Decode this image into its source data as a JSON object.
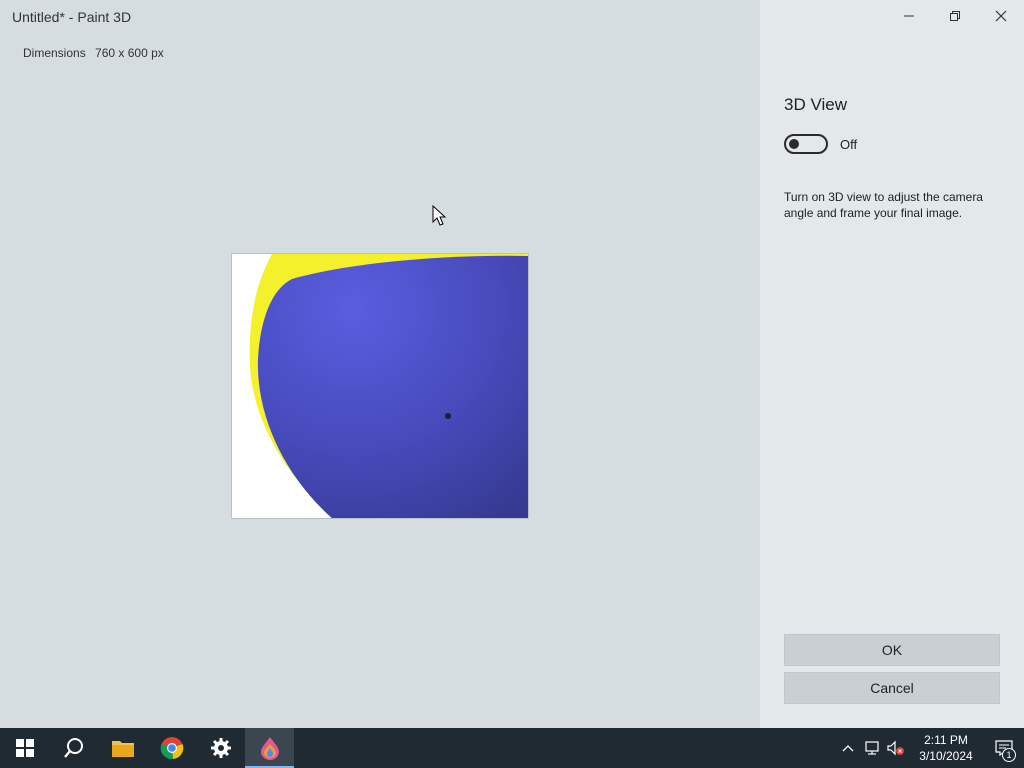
{
  "window": {
    "title": "Untitled* - Paint 3D",
    "dimensions_label": "Dimensions",
    "dimensions_value": "760 x 600 px"
  },
  "panel": {
    "title": "3D View",
    "toggle_state_label": "Off",
    "toggle_on": false,
    "description": "Turn on 3D view to adjust the camera angle and frame your final image.",
    "ok_label": "OK",
    "cancel_label": "Cancel"
  },
  "canvas": {
    "colors": {
      "background": "#ffffff",
      "sphere": "#4b4fc8",
      "rim": "#f4f02c",
      "dot": "#1b1b3a"
    }
  },
  "taskbar": {
    "apps": [
      "start-icon",
      "search-icon",
      "file-explorer-icon",
      "chrome-icon",
      "settings-icon",
      "paint3d-icon"
    ],
    "active_app": "paint3d-icon",
    "time": "2:11 PM",
    "date": "3/10/2024",
    "notification_count": "1"
  }
}
